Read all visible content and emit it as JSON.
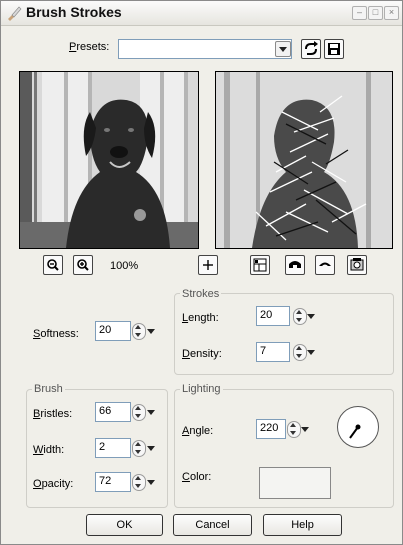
{
  "window": {
    "title": "Brush Strokes"
  },
  "presets": {
    "label": "Presets:",
    "value": ""
  },
  "zoom": {
    "level": "100%"
  },
  "softness": {
    "label": "Softness:",
    "value": "20"
  },
  "strokes": {
    "title": "Strokes",
    "length_label": "Length:",
    "length_value": "20",
    "density_label": "Density:",
    "density_value": "7"
  },
  "brush": {
    "title": "Brush",
    "bristles_label": "Bristles:",
    "bristles_value": "66",
    "width_label": "Width:",
    "width_value": "2",
    "opacity_label": "Opacity:",
    "opacity_value": "72"
  },
  "lighting": {
    "title": "Lighting",
    "angle_label": "Angle:",
    "angle_value": "220",
    "color_label": "Color:",
    "color_value": "#f4f4f2"
  },
  "buttons": {
    "ok": "OK",
    "cancel": "Cancel",
    "help": "Help"
  },
  "icons": [
    "brush-app-icon",
    "minimize-icon",
    "maximize-icon",
    "close-icon",
    "load-preset-icon",
    "save-preset-icon",
    "zoom-out-icon",
    "zoom-in-icon",
    "pan-icon",
    "proof-icon",
    "randomize-icon",
    "reset-icon",
    "help-icon"
  ]
}
